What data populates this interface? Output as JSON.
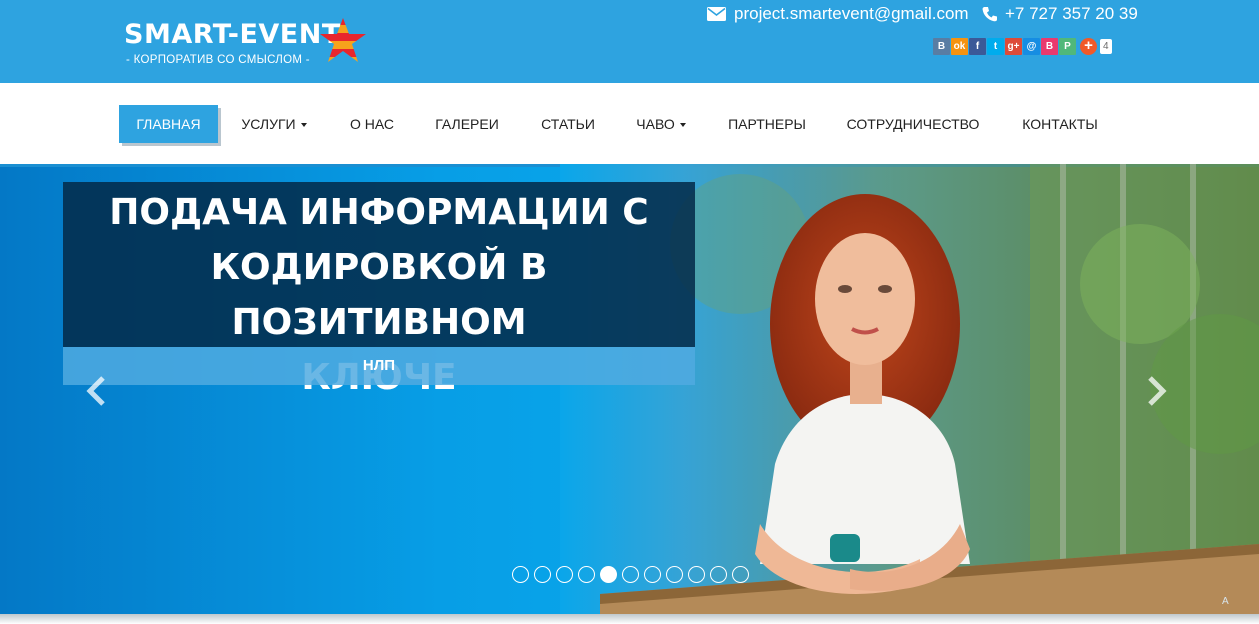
{
  "brand": {
    "title": "SMART-EVENT",
    "tagline": "- КОРПОРАТИВ СО СМЫСЛОМ -"
  },
  "contacts": {
    "email": "project.smartevent@gmail.com",
    "phone": "+7 727 357 20 39"
  },
  "share": {
    "buttons": [
      {
        "icon": "vk-icon",
        "label": "B",
        "color": "#597da3"
      },
      {
        "icon": "odnoklassniki-icon",
        "label": "ok",
        "color": "#f59310"
      },
      {
        "icon": "facebook-icon",
        "label": "f",
        "color": "#3b5998"
      },
      {
        "icon": "twitter-icon",
        "label": "t",
        "color": "#00aced"
      },
      {
        "icon": "google-plus-icon",
        "label": "g+",
        "color": "#dd4b39"
      },
      {
        "icon": "mail-icon",
        "label": "@",
        "color": "#168de2"
      },
      {
        "icon": "bookmark-icon",
        "label": "B",
        "color": "#ea3a6e"
      },
      {
        "icon": "print-icon",
        "label": "P",
        "color": "#50b87a"
      }
    ],
    "plus_color": "#f05a29",
    "count": "4"
  },
  "nav": {
    "items": [
      {
        "label": "ГЛАВНАЯ",
        "active": true,
        "dropdown": false
      },
      {
        "label": "УСЛУГИ",
        "active": false,
        "dropdown": true
      },
      {
        "label": "О НАС",
        "active": false,
        "dropdown": false
      },
      {
        "label": "ГАЛЕРЕИ",
        "active": false,
        "dropdown": false
      },
      {
        "label": "СТАТЬИ",
        "active": false,
        "dropdown": false
      },
      {
        "label": "ЧАВО",
        "active": false,
        "dropdown": true
      },
      {
        "label": "ПАРТНЕРЫ",
        "active": false,
        "dropdown": false
      },
      {
        "label": "СОТРУДНИЧЕСТВО",
        "active": false,
        "dropdown": false
      },
      {
        "label": "КОНТАКТЫ",
        "active": false,
        "dropdown": false
      }
    ]
  },
  "slider": {
    "title_lines": [
      "ПОДАЧА ИНФОРМАЦИИ С",
      "КОДИРОВКОЙ В ПОЗИТИВНОМ",
      "КЛЮЧЕ"
    ],
    "subtitle": "НЛП",
    "slide_count": 11,
    "current_slide": 5
  },
  "colors": {
    "brand_blue": "#2ea3e0"
  }
}
